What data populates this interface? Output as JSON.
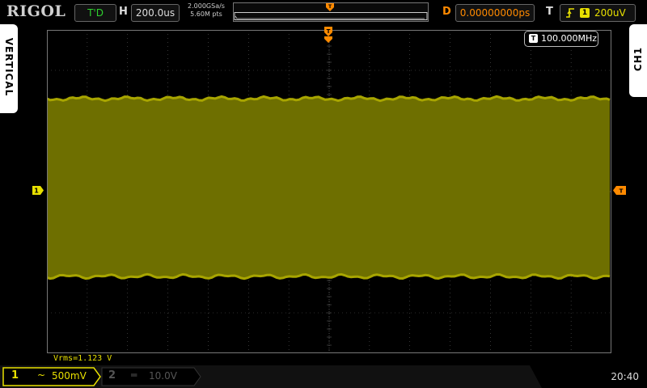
{
  "brand": "RIGOL",
  "trigger_status": "T'D",
  "horizontal": {
    "label": "H",
    "timebase": "200.0us"
  },
  "acquisition": {
    "sample_rate": "2.000GSa/s",
    "memory_depth": "5.60M pts"
  },
  "delay": {
    "label": "D",
    "value": "0.00000000ps"
  },
  "trigger": {
    "label": "T",
    "edge_icon": "rising-edge-icon",
    "source": "1",
    "level": "200uV"
  },
  "side_tabs": {
    "left": "VERTICAL",
    "right": "CH1"
  },
  "frequency_counter": {
    "icon": "T",
    "value": "100.000MHz"
  },
  "channel_marker": "1",
  "measurement": "Vrms=1.123 V",
  "channels": [
    {
      "number": "1",
      "coupling": "~",
      "scale": "500mV",
      "active": true
    },
    {
      "number": "2",
      "coupling": "═",
      "scale": "10.0V",
      "active": false
    }
  ],
  "clock": "20:40",
  "colors": {
    "ch1": "#e8e000",
    "trace_fill": "#6e6f00",
    "trace_edge": "#a8a500",
    "trigger": "#ff8a00",
    "grid": "#5a5a5a",
    "inactive": "#555555"
  }
}
